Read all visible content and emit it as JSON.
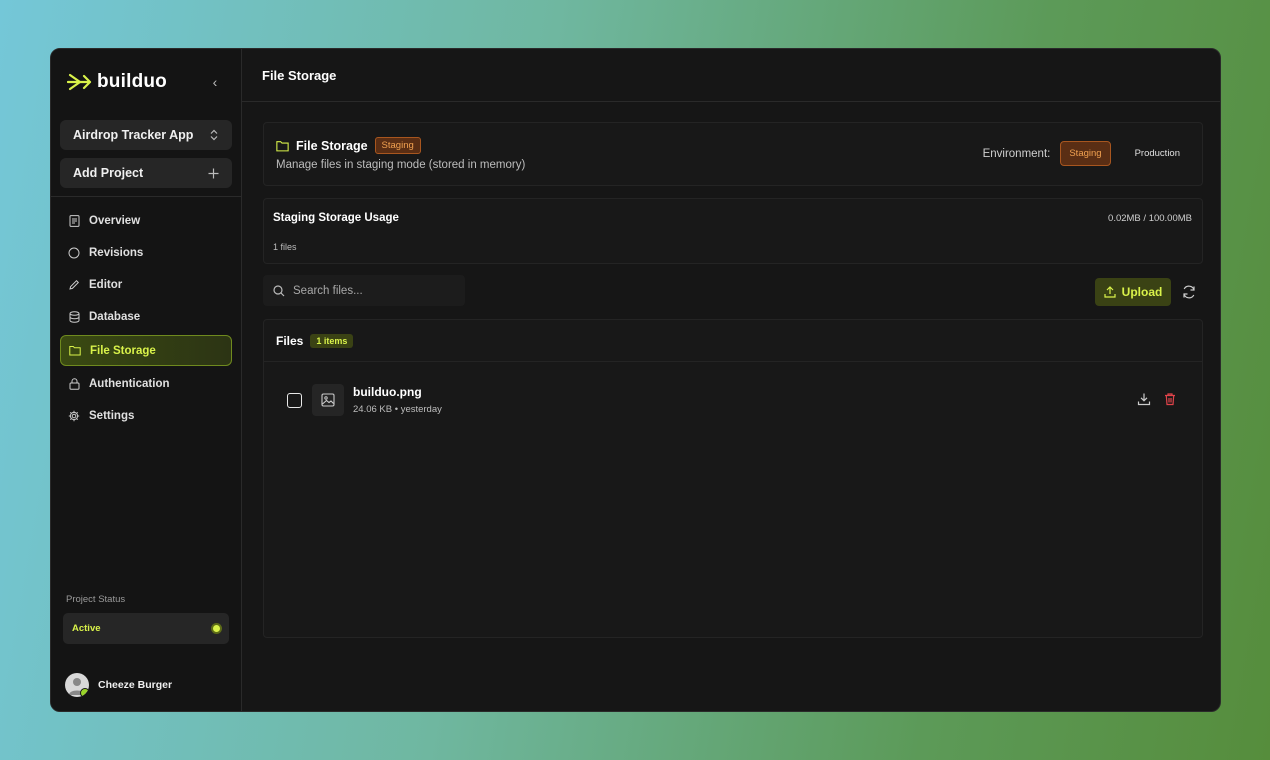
{
  "brand": {
    "name": "builduo",
    "accent": "#d9f24a"
  },
  "sidebar": {
    "project_select": "Airdrop Tracker App",
    "add_project": "Add Project",
    "items": [
      {
        "label": "Overview",
        "icon": "document-icon"
      },
      {
        "label": "Revisions",
        "icon": "circle-icon"
      },
      {
        "label": "Editor",
        "icon": "pencil-icon"
      },
      {
        "label": "Database",
        "icon": "database-icon"
      },
      {
        "label": "File Storage",
        "icon": "folder-icon",
        "active": true
      },
      {
        "label": "Authentication",
        "icon": "lock-icon"
      },
      {
        "label": "Settings",
        "icon": "gear-icon"
      }
    ],
    "status_label": "Project Status",
    "status_value": "Active",
    "user_name": "Cheeze Burger"
  },
  "header": {
    "title": "File Storage"
  },
  "env_card": {
    "title": "File Storage",
    "badge": "Staging",
    "subtitle": "Manage files in staging mode (stored in memory)",
    "env_label": "Environment:",
    "env_options": [
      "Staging",
      "Production"
    ],
    "selected_env": "Staging"
  },
  "usage": {
    "title": "Staging Storage Usage",
    "value": "0.02MB / 100.00MB",
    "count": "1 files"
  },
  "search": {
    "placeholder": "Search files..."
  },
  "toolbar": {
    "upload_label": "Upload"
  },
  "files": {
    "title": "Files",
    "count_badge": "1 items",
    "rows": [
      {
        "name": "builduo.png",
        "meta": "24.06 KB • yesterday"
      }
    ]
  }
}
